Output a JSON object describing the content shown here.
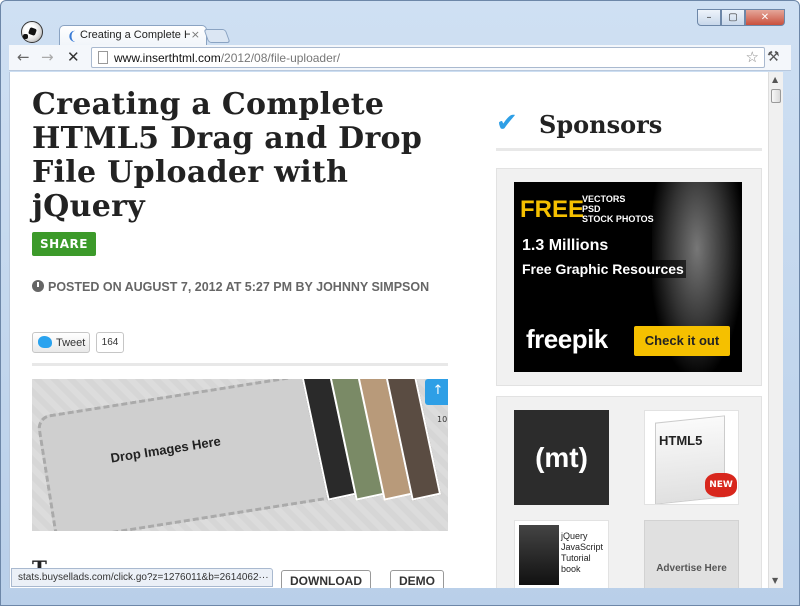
{
  "browser": {
    "tab_title": "Creating a Complete HT",
    "tab_close": "×",
    "url_host": "www.inserthtml.com",
    "url_path": "/2012/08/file-uploader/",
    "status_url": "stats.buysellads.com/click.go?z=1276011&b=2614062···",
    "window_minimize": "–",
    "window_maximize": "▢",
    "window_close": "✕",
    "back_icon": "←",
    "forward_icon": "→",
    "stop_icon": "✕",
    "star_icon": "☆",
    "wrench_icon": "🔧"
  },
  "article": {
    "title": "Creating a Complete HTML5 Drag and Drop File Uploader with jQuery",
    "share_label": "SHARE",
    "posted": "POSTED ON AUGUST 7, 2012 AT 5:27 PM BY JOHNNY SIMPSON",
    "tweet_label": "Tweet",
    "tweet_count": "164",
    "hero_drop_text": "Drop Images Here",
    "hero_counter": "10",
    "download_label": "DOWNLOAD",
    "demo_label": "DEMO",
    "next_heading": "T"
  },
  "sidebar": {
    "check_icon": "✔",
    "heading": "Sponsors",
    "freepik": {
      "free": "FREE",
      "categories": [
        "VECTORS",
        "PSD",
        "STOCK PHOTOS"
      ],
      "millions": "1.3 Millions",
      "resources": "Free Graphic Resources",
      "logo": "freepik",
      "cta": "Check it out"
    },
    "ads": {
      "mt_label": "(mt)",
      "html5_label": "HTML5",
      "html5_new": "NEW",
      "jquery_lines": [
        "jQuery",
        "JavaScript",
        "Tutorial",
        "book"
      ],
      "advertise_label": "Advertise Here"
    }
  }
}
